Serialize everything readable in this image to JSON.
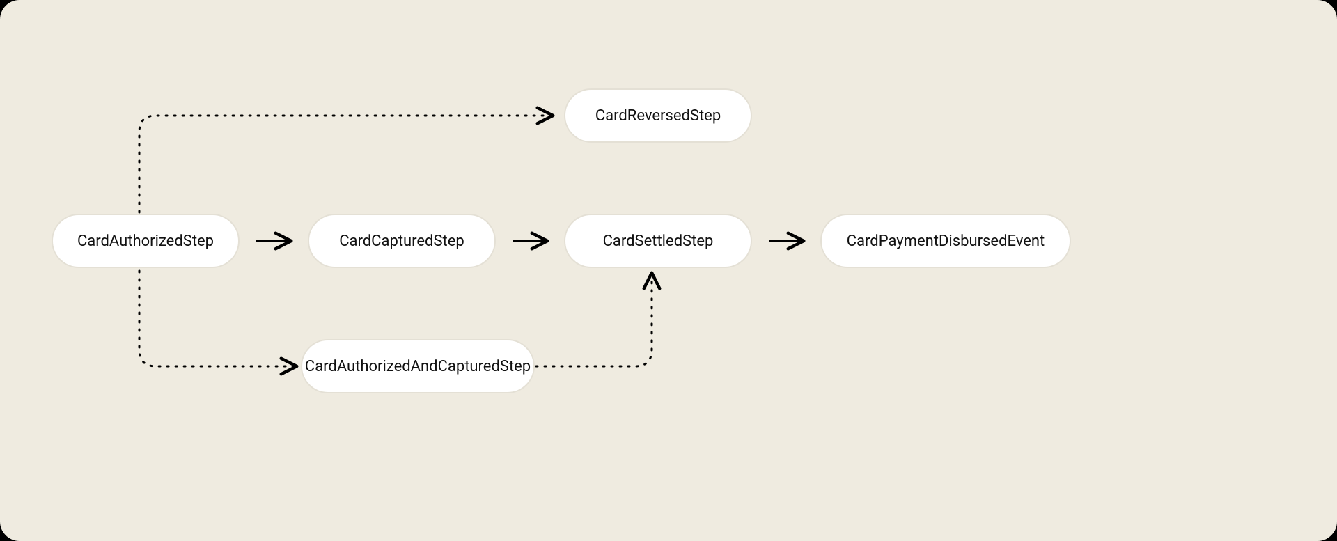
{
  "diagram": {
    "nodes": {
      "authorized": "CardAuthorizedStep",
      "captured": "CardCapturedStep",
      "settled": "CardSettledStep",
      "disbursed": "CardPaymentDisbursedEvent",
      "reversed": "CardReversedStep",
      "authAndCaptured": "CardAuthorizedAndCapturedStep"
    },
    "edges": [
      {
        "from": "authorized",
        "to": "captured",
        "style": "solid"
      },
      {
        "from": "captured",
        "to": "settled",
        "style": "solid"
      },
      {
        "from": "settled",
        "to": "disbursed",
        "style": "solid"
      },
      {
        "from": "authorized",
        "to": "reversed",
        "style": "dotted"
      },
      {
        "from": "authorized",
        "to": "authAndCaptured",
        "style": "dotted"
      },
      {
        "from": "authAndCaptured",
        "to": "settled",
        "style": "dotted"
      }
    ]
  }
}
